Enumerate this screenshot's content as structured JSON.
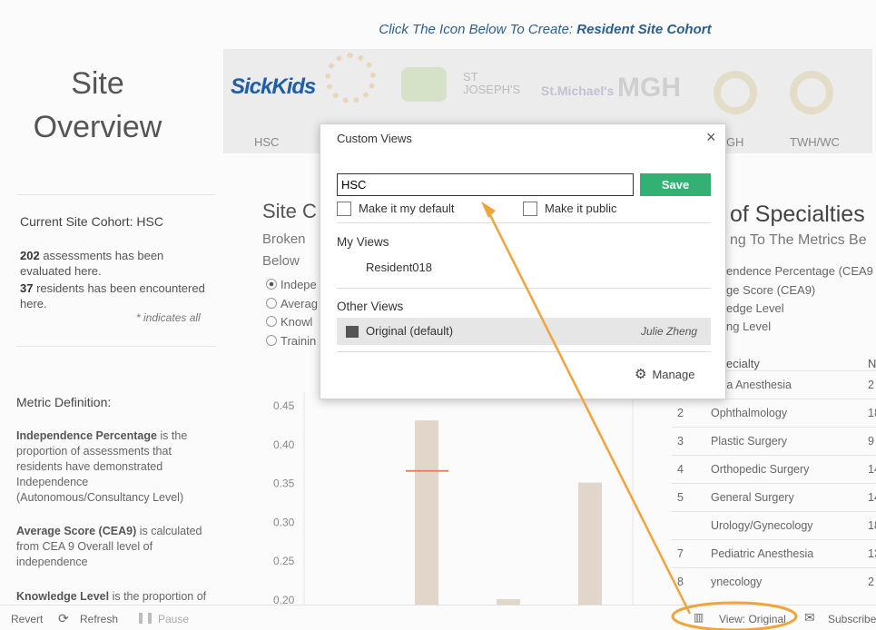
{
  "header": {
    "instruction_prefix": "Click The Icon Below To Create: ",
    "instruction_emph": "Resident Site Cohort"
  },
  "page_title_line1": "Site",
  "page_title_line2": "Overview",
  "logos": {
    "sickkids": "SickKids",
    "stjoseph_top": "ST",
    "stjoseph": "JOSEPH'S",
    "stmichaels": "St.Michael's",
    "mgh": "MGH"
  },
  "tabs": [
    "HSC",
    "TGH",
    "TWH/WC"
  ],
  "cohort": {
    "title": "Current Site Cohort: HSC",
    "assess_count": "202",
    "assess_text": " assessments has been evaluated here.",
    "res_count": "37",
    "res_text": " residents has been encountered here.",
    "note": "* indicates all"
  },
  "metric": {
    "title": "Metric Definition:",
    "def1_term": "Independence Percentage",
    "def1_text": " is the proportion of assessments that residents have demonstrated Independence (Autonomous/Consultancy Level)",
    "def2_term": "Average Score (CEA9)",
    "def2_text": " is calculated from CEA 9 Overall level of independence",
    "def3_term": "Knowledge Level",
    "def3_text": " is the proportion of"
  },
  "site_section": {
    "title": "Site C",
    "sub1": "Broken",
    "sub2": "Below",
    "radios": [
      "Indepe",
      "Averag",
      "Knowl",
      "Trainin"
    ]
  },
  "chart_data": {
    "type": "bar",
    "yticks": [
      "0.45",
      "0.40",
      "0.35",
      "0.30",
      "0.25",
      "0.20"
    ],
    "ylim": [
      0.2,
      0.45
    ],
    "bars": [
      0.43,
      0.2,
      0.35
    ],
    "target_line": 0.365
  },
  "specialties": {
    "title": "of Specialties",
    "subtitle": "ng To The Metrics Be",
    "lines": [
      "endence Percentage (CEA9",
      "ge Score (CEA9)",
      "edge Level",
      "ng Level"
    ],
    "col_head": "ecialty",
    "col_head2": "N",
    "rows": [
      {
        "n": "",
        "name": "uma Anesthesia",
        "v": "2"
      },
      {
        "n": "2",
        "name": "Ophthalmology",
        "v": "18"
      },
      {
        "n": "3",
        "name": "Plastic Surgery",
        "v": "9"
      },
      {
        "n": "4",
        "name": "Orthopedic Surgery",
        "v": "14"
      },
      {
        "n": "5",
        "name": "General Surgery",
        "v": "14"
      },
      {
        "n": "",
        "name": "Urology/Gynecology",
        "v": "18"
      },
      {
        "n": "7",
        "name": "Pediatric Anesthesia",
        "v": "13"
      },
      {
        "n": "8",
        "name": "ynecology",
        "v": "2"
      }
    ]
  },
  "footer": {
    "revert": "Revert",
    "refresh": "Refresh",
    "pause": "Pause",
    "view": "View: Original",
    "subscribe": "Subscribe"
  },
  "dialog": {
    "title": "Custom Views",
    "close": "×",
    "input_value": "HSC",
    "save": "Save",
    "default_label": "Make it my default",
    "public_label": "Make it public",
    "my_views": "My Views",
    "my_view_item": "Resident018",
    "other_views": "Other Views",
    "other_item": "Original (default)",
    "other_owner": "Julie Zheng",
    "manage": "Manage"
  },
  "colors": {
    "accent": "#33b074",
    "annotation": "#f0a43a",
    "title_blue": "#2c5f8a"
  }
}
